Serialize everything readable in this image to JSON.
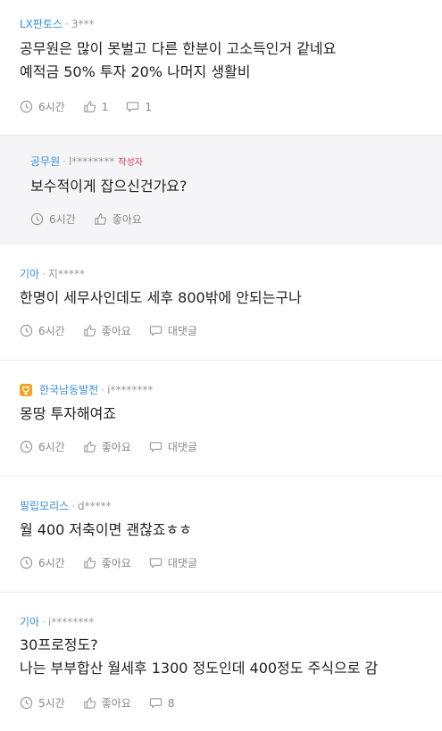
{
  "comments": [
    {
      "company": "LX판토스",
      "user": "3***",
      "lines": [
        "공무원은 많이 못벌고 다른 한분이 고소득인거 같네요",
        "예적금 50% 투자 20% 나머지 생활비"
      ],
      "time": "6시간",
      "likes": "1",
      "replies": "1"
    },
    {
      "company": "공무원",
      "user": "l********",
      "author_tag": "작성자",
      "lines": [
        "보수적이게 잡으신건가요?"
      ],
      "time": "6시간",
      "likes": "좋아요"
    },
    {
      "company": "기아",
      "user": "지*****",
      "lines": [
        "한명이 세무사인데도 세후 800밖에 안되는구나"
      ],
      "time": "6시간",
      "likes": "좋아요",
      "replies": "대댓글"
    },
    {
      "company": "한국남동발전",
      "user": "i********",
      "lines": [
        "몽땅 투자해여죠"
      ],
      "time": "6시간",
      "likes": "좋아요",
      "replies": "대댓글"
    },
    {
      "company": "필립모리스",
      "user": "d*****",
      "lines": [
        "월 400 저축이면 괜찮죠ㅎㅎ"
      ],
      "time": "6시간",
      "likes": "좋아요",
      "replies": "대댓글"
    },
    {
      "company": "기아",
      "user": "i********",
      "lines": [
        "30프로정도?",
        "나는 부부합산 월세후 1300 정도인데 400정도 주식으로 감"
      ],
      "time": "5시간",
      "likes": "좋아요",
      "replies": "8"
    }
  ],
  "colors": {
    "company": "#3a8fd6",
    "author_tag": "#e0364c",
    "badge": "#f2a321"
  }
}
